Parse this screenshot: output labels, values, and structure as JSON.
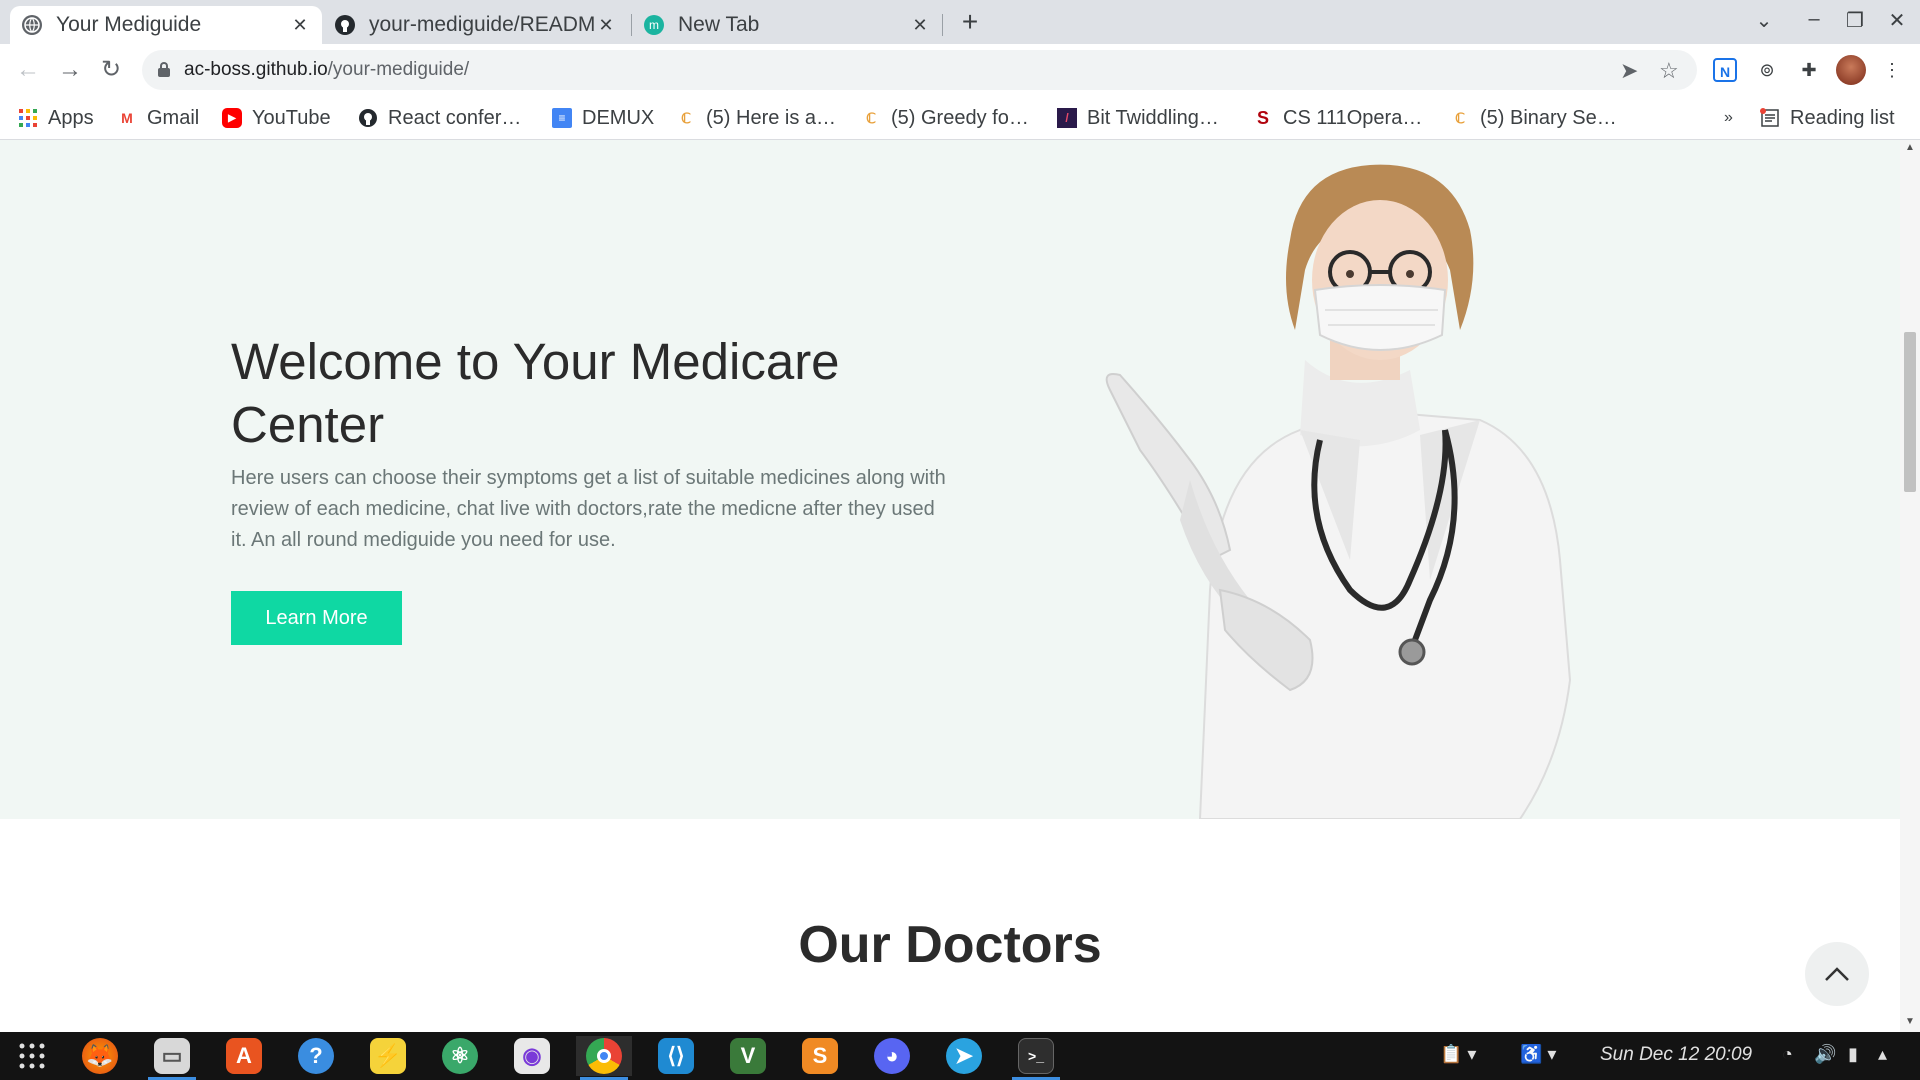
{
  "browser": {
    "tabs": [
      {
        "title": "Your Mediguide",
        "active": true
      },
      {
        "title": "your-mediguide/READM",
        "active": false
      },
      {
        "title": "New Tab",
        "active": false
      }
    ],
    "new_tab": "+",
    "address": {
      "host": "ac-boss.github.io",
      "path": "/your-mediguide/"
    },
    "bookmarks": [
      {
        "label": "Apps",
        "icon": "apps-grid-icon"
      },
      {
        "label": "Gmail",
        "icon": "gmail-icon"
      },
      {
        "label": "YouTube",
        "icon": "youtube-icon"
      },
      {
        "label": "React confer…",
        "icon": "github-icon"
      },
      {
        "label": "DEMUX",
        "icon": "docs-icon"
      },
      {
        "label": "(5) Here is a…",
        "icon": "leetcode-icon"
      },
      {
        "label": "(5) Greedy fo…",
        "icon": "leetcode-icon"
      },
      {
        "label": "Bit Twiddling…",
        "icon": "bit-twiddling-icon"
      },
      {
        "label": "CS 111Opera…",
        "icon": "stanford-icon"
      },
      {
        "label": "(5) Binary Se…",
        "icon": "leetcode-icon"
      }
    ],
    "bookmarks_overflow": "»",
    "reading_list": "Reading list"
  },
  "page": {
    "hero": {
      "title": "Welcome to Your Medicare Center",
      "description": "Here users can choose their symptoms get a list of suitable medicines along with review of each medicine, chat live with doctors,rate the medicne after they used it. An all round mediguide you need for use.",
      "button": "Learn More"
    },
    "section_title": "Our Doctors"
  },
  "taskbar": {
    "apps": [
      "show-apps-icon",
      "firefox-icon",
      "files-icon",
      "software-center-icon",
      "help-icon",
      "pikachu-icon",
      "atom-icon",
      "camera-icon",
      "chrome-icon",
      "vscode-icon",
      "vim-icon",
      "sublime-text-icon",
      "discord-icon",
      "telegram-icon",
      "terminal-icon"
    ],
    "clock": "Sun Dec 12  20:09"
  },
  "colors": {
    "accent": "#0fd8a3",
    "hero_background": "#f1f7f4",
    "tabstrip": "#dee1e6"
  }
}
